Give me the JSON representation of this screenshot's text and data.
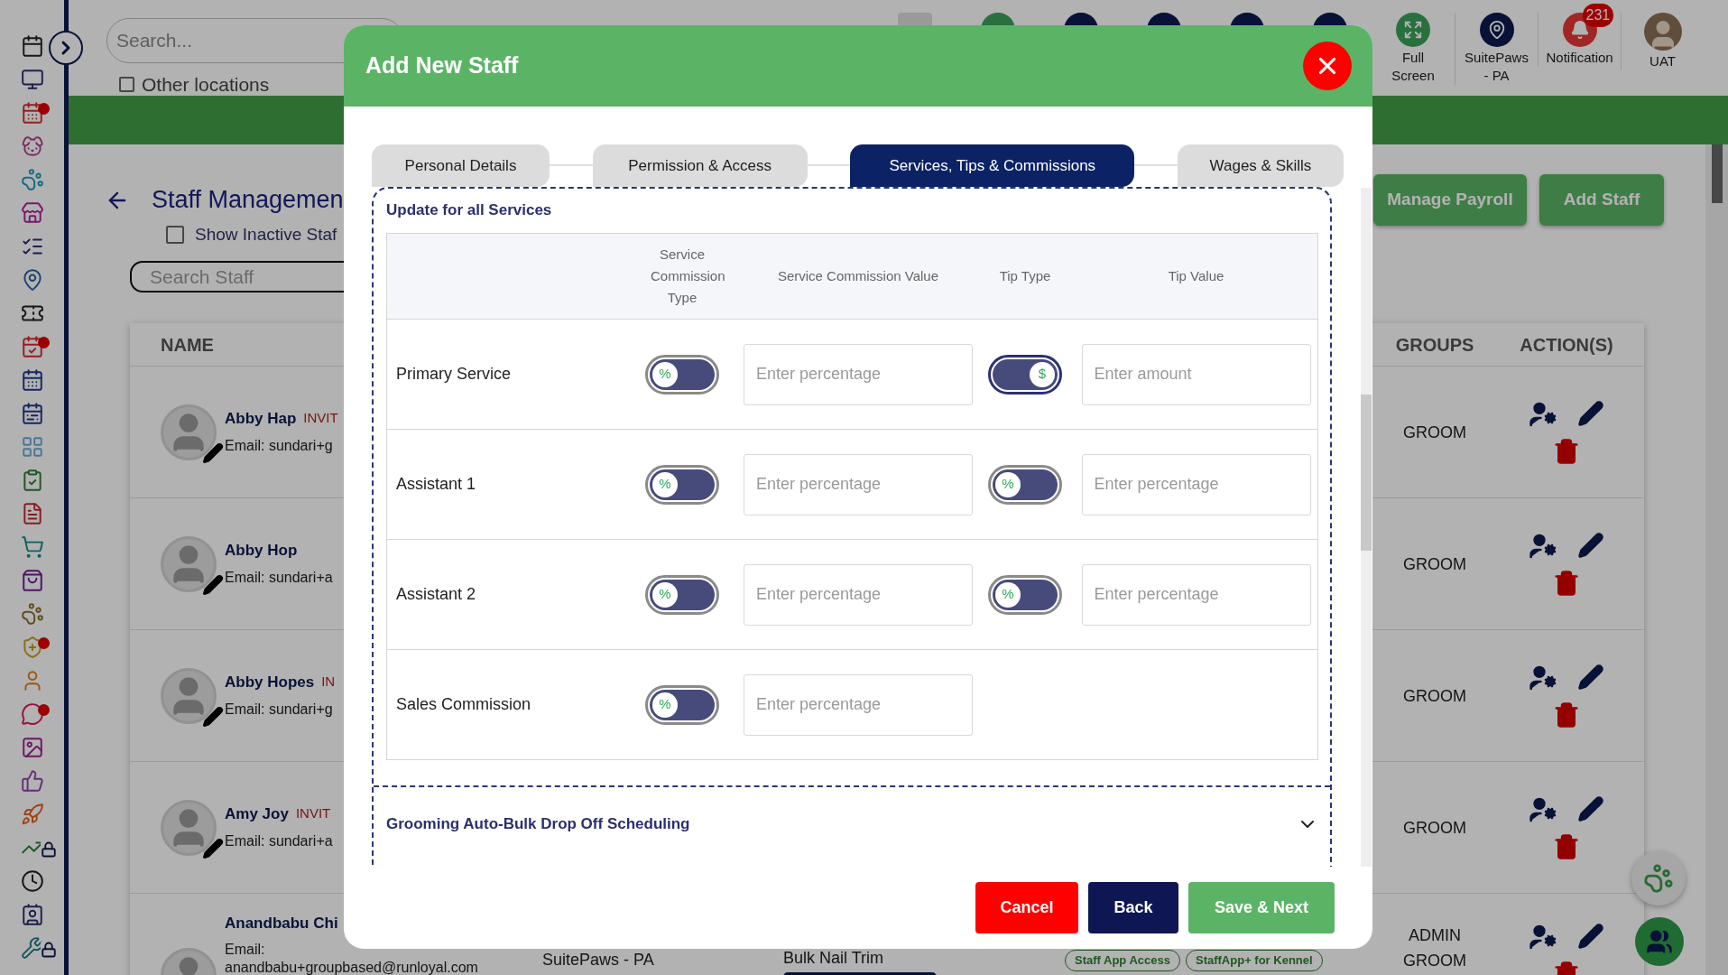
{
  "sidebar": {
    "items": [
      {
        "dot": false,
        "locked": false
      },
      {
        "dot": false,
        "locked": false
      },
      {
        "dot": true,
        "locked": false
      },
      {
        "dot": false,
        "locked": false
      },
      {
        "dot": false,
        "locked": false
      },
      {
        "dot": false,
        "locked": false
      },
      {
        "dot": false,
        "locked": false
      },
      {
        "dot": false,
        "locked": false
      },
      {
        "dot": false,
        "locked": false
      },
      {
        "dot": true,
        "locked": false
      },
      {
        "dot": false,
        "locked": false
      },
      {
        "dot": false,
        "locked": false
      },
      {
        "dot": false,
        "locked": false
      },
      {
        "dot": false,
        "locked": false
      },
      {
        "dot": false,
        "locked": false
      },
      {
        "dot": false,
        "locked": false
      },
      {
        "dot": false,
        "locked": false
      },
      {
        "dot": false,
        "locked": false
      },
      {
        "dot": true,
        "locked": false
      },
      {
        "dot": false,
        "locked": false
      },
      {
        "dot": true,
        "locked": false
      },
      {
        "dot": false,
        "locked": false
      },
      {
        "dot": false,
        "locked": false
      },
      {
        "dot": false,
        "locked": false
      },
      {
        "dot": false,
        "locked": true
      },
      {
        "dot": false,
        "locked": false
      },
      {
        "dot": false,
        "locked": false
      },
      {
        "dot": false,
        "locked": true
      }
    ]
  },
  "top_bar": {
    "search": {
      "placeholder": "Search..."
    },
    "other_locations": {
      "label": "Other locations",
      "checked": false
    },
    "actions": [
      {
        "label": "Full Screen"
      },
      {
        "label": "SuitePaws - PA"
      },
      {
        "label": "Notification",
        "badge": "231"
      },
      {
        "label": "UAT"
      }
    ]
  },
  "page": {
    "title": "Staff Managemen",
    "show_inactive": {
      "label": "Show Inactive Staf",
      "checked": false
    },
    "search": {
      "placeholder": "Search Staff"
    },
    "buttons": [
      "Manage Payroll",
      "Add Staff"
    ],
    "table": {
      "columns": [
        "NAME",
        "GROUPS",
        "ACTION(S)"
      ],
      "rows": [
        {
          "name": "Abby Hap",
          "status": "INVIT",
          "email": "Email: sundari+g",
          "groups": [
            "GROOM"
          ]
        },
        {
          "name": "Abby Hop",
          "email": "Email: sundari+a",
          "groups": [
            "GROOM"
          ]
        },
        {
          "name": "Abby Hopes",
          "status": "IN",
          "email": "Email: sundari+g",
          "groups": [
            "GROOM"
          ]
        },
        {
          "name": "Amy Joy",
          "status": "INVIT",
          "email": "Email: sundari+a",
          "groups": [
            "GROOM"
          ]
        },
        {
          "name": "Anandbabu Chi",
          "email_label": "Email:",
          "email": "anandbabu+groupbased@runloyal.com",
          "location": "SuitePaws - PA",
          "service": "Bulk Nail Trim",
          "tags": [
            "Staff App Access",
            "StaffApp+ for Kennel"
          ],
          "groups": [
            "ADMIN",
            "GROOM"
          ]
        }
      ]
    }
  },
  "modal": {
    "title": "Add New Staff",
    "tabs": [
      {
        "label": "Personal Details",
        "selected": false
      },
      {
        "label": "Permission & Access",
        "selected": false
      },
      {
        "label": "Services, Tips & Commissions",
        "selected": true
      },
      {
        "label": "Wages & Skills",
        "selected": false
      }
    ],
    "section_title": "Update for all Services",
    "columns": [
      "Service Commission Type",
      "Service Commission Value",
      "Tip Type",
      "Tip Value"
    ],
    "rows": [
      {
        "label": "Primary Service",
        "commission_toggle": {
          "symbol": "%",
          "on": false
        },
        "commission_placeholder": "Enter percentage",
        "tip_toggle": {
          "symbol": "$",
          "on": true
        },
        "tip_placeholder": "Enter amount"
      },
      {
        "label": "Assistant 1",
        "commission_toggle": {
          "symbol": "%",
          "on": false
        },
        "commission_placeholder": "Enter percentage",
        "tip_toggle": {
          "symbol": "%",
          "on": false
        },
        "tip_placeholder": "Enter percentage"
      },
      {
        "label": "Assistant 2",
        "commission_toggle": {
          "symbol": "%",
          "on": false
        },
        "commission_placeholder": "Enter percentage",
        "tip_toggle": {
          "symbol": "%",
          "on": false
        },
        "tip_placeholder": "Enter percentage"
      },
      {
        "label": "Sales Commission",
        "commission_toggle": {
          "symbol": "%",
          "on": false
        },
        "commission_placeholder": "Enter percentage"
      }
    ],
    "accordion": {
      "title": "Grooming Auto-Bulk Drop Off Scheduling",
      "expanded": false
    },
    "buttons": [
      {
        "label": "Cancel",
        "kind": "danger"
      },
      {
        "label": "Back",
        "kind": "secondary"
      },
      {
        "label": "Save & Next",
        "kind": "primary"
      }
    ]
  }
}
